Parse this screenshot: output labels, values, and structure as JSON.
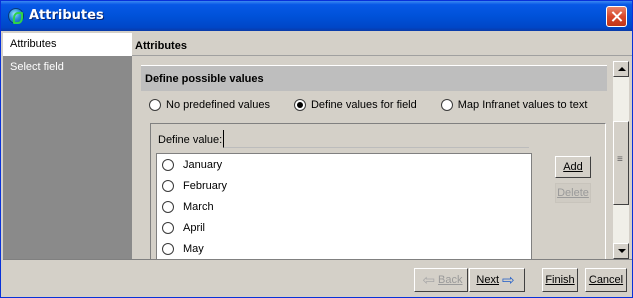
{
  "window": {
    "title": "Attributes"
  },
  "sidebar": {
    "items": [
      {
        "label": "Attributes"
      },
      {
        "label": "Select field"
      }
    ]
  },
  "content": {
    "header": "Attributes",
    "section_title": "Define possible values",
    "value_options": [
      {
        "label": "No predefined values",
        "selected": false
      },
      {
        "label": "Define values for field",
        "selected": true
      },
      {
        "label": "Map Infranet values to text",
        "selected": false
      }
    ],
    "define_value_label": "Define value:",
    "define_value_input": "",
    "values": [
      "January",
      "February",
      "March",
      "April",
      "May"
    ],
    "add_label": "Add",
    "delete_label": "Delete"
  },
  "footer": {
    "back_label": "Back",
    "next_label": "Next",
    "finish_label": "Finish",
    "cancel_label": "Cancel"
  }
}
